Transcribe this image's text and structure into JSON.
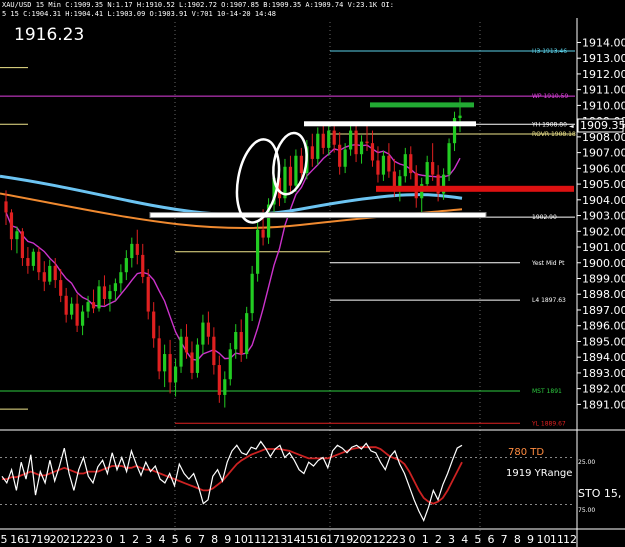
{
  "header": {
    "line1": "XAU/USD 15 Min C:1909.35 N:1.17 H:1910.52 L:1902.72 O:1907.85 B:1909.35 A:1909.74 V:23.1K OI:",
    "line2": "5 15 C:1904.31 H:1904.41 L:1903.09 O:1903.91 V:701 10-14-20 14:48"
  },
  "big_price": "1916.23",
  "current_price": "1909.35",
  "chart_data": {
    "type": "candlestick",
    "symbol": "XAU/USD",
    "timeframe": "15 Min",
    "ylim": [
      1889.5,
      1915.3
    ],
    "y_ticks": [
      1891,
      1892,
      1893,
      1894,
      1895,
      1896,
      1897,
      1898,
      1899,
      1900,
      1901,
      1902,
      1903,
      1904,
      1905,
      1906,
      1907,
      1908,
      1909,
      1910,
      1911,
      1912,
      1913,
      1914
    ],
    "y_tick_labels": [
      "1891.00",
      "1892.00",
      "1893.00",
      "1894.00",
      "1895.00",
      "1896.00",
      "1897.00",
      "1898.00",
      "1899.00",
      "1900.00",
      "1901.00",
      "1902.00",
      "1903.00",
      "1904.00",
      "1905.00",
      "1906.00",
      "1907.00",
      "1908.00",
      "1909.00",
      "1910.00",
      "1911.00",
      "1912.00",
      "1913.00",
      "1914.00"
    ],
    "x_labels": [
      "5",
      "16",
      "17",
      "19",
      "20",
      "21",
      "22",
      "23",
      "0",
      "1",
      "2",
      "3",
      "4",
      "5",
      "6",
      "7",
      "8",
      "9",
      "10",
      "11",
      "12",
      "13",
      "14",
      "15",
      "16",
      "17",
      "19",
      "20",
      "21",
      "22",
      "23",
      "0",
      "1",
      "2",
      "3",
      "4",
      "5",
      "6",
      "7",
      "8",
      "9",
      "10",
      "11",
      "12"
    ],
    "levels": [
      {
        "label": "H3 1913.46",
        "value": 1913.46,
        "color": "#5ad1e8"
      },
      {
        "label": "WP 1910.59",
        "value": 1910.59,
        "color": "#e040e0"
      },
      {
        "label": "YH 1908.80",
        "value": 1908.8,
        "color": "#ffffff"
      },
      {
        "label": "ROVR 1908.18",
        "value": 1908.18,
        "color": "#f0e68c"
      },
      {
        "label": "1902.90",
        "value": 1902.9,
        "color": "#ffffff"
      },
      {
        "label": "Yest Mid Pt",
        "value": 1900.0,
        "color": "#ffffff"
      },
      {
        "label": "L4 1897.63",
        "value": 1897.63,
        "color": "#ffffff"
      },
      {
        "label": "MST 1891",
        "value": 1891.85,
        "color": "#2ecc40"
      },
      {
        "label": "YL 1889.67",
        "value": 1889.8,
        "color": "#e02020"
      }
    ],
    "oscillator": {
      "label": "STO 15,",
      "td_label": "780 TD",
      "yrange_label": "1919 YRange",
      "levels": [
        "25.00",
        "75.00"
      ],
      "fast": [
        55,
        48,
        62,
        40,
        70,
        52,
        78,
        35,
        60,
        48,
        72,
        50,
        66,
        85,
        58,
        40,
        62,
        75,
        55,
        48,
        65,
        72,
        58,
        80,
        62,
        75,
        60,
        82,
        68,
        56,
        70,
        60,
        66,
        52,
        48,
        58,
        45,
        68,
        58,
        52,
        58,
        44,
        26,
        30,
        55,
        62,
        50,
        70,
        82,
        88,
        80,
        78,
        86,
        84,
        92,
        85,
        76,
        84,
        88,
        75,
        80,
        72,
        62,
        58,
        70,
        66,
        72,
        75,
        64,
        82,
        88,
        85,
        80,
        86,
        88,
        84,
        90,
        82,
        80,
        70,
        62,
        76,
        82,
        68,
        58,
        44,
        30,
        18,
        8,
        22,
        40,
        30,
        46,
        58,
        72,
        85,
        88
      ],
      "slow": [
        52,
        52,
        54,
        54,
        56,
        58,
        60,
        58,
        56,
        56,
        58,
        60,
        62,
        64,
        62,
        60,
        58,
        58,
        60,
        60,
        60,
        62,
        64,
        66,
        66,
        66,
        64,
        64,
        66,
        64,
        62,
        62,
        60,
        58,
        56,
        54,
        52,
        50,
        48,
        46,
        44,
        42,
        40,
        40,
        42,
        46,
        50,
        56,
        62,
        68,
        72,
        75,
        78,
        80,
        82,
        84,
        84,
        84,
        84,
        83,
        82,
        80,
        78,
        76,
        74,
        74,
        74,
        74,
        74,
        76,
        78,
        80,
        82,
        84,
        85,
        86,
        86,
        86,
        86,
        84,
        80,
        76,
        74,
        72,
        68,
        60,
        50,
        40,
        32,
        28,
        26,
        28,
        32,
        40,
        50,
        60,
        70
      ]
    },
    "candles": [
      [
        1903.9,
        1904.6,
        1902.4,
        1903.2
      ],
      [
        1903.2,
        1903.4,
        1900.8,
        1901.5
      ],
      [
        1901.5,
        1902.3,
        1900.6,
        1902.0
      ],
      [
        1902.0,
        1902.2,
        1899.8,
        1900.3
      ],
      [
        1900.3,
        1901.0,
        1899.3,
        1899.8
      ],
      [
        1899.8,
        1900.9,
        1899.5,
        1900.7
      ],
      [
        1900.7,
        1901.0,
        1898.9,
        1899.4
      ],
      [
        1899.4,
        1900.1,
        1898.2,
        1898.8
      ],
      [
        1898.8,
        1900.2,
        1898.6,
        1899.8
      ],
      [
        1899.8,
        1900.3,
        1898.4,
        1898.9
      ],
      [
        1898.9,
        1899.6,
        1897.5,
        1897.9
      ],
      [
        1897.9,
        1898.4,
        1896.2,
        1896.7
      ],
      [
        1896.7,
        1897.8,
        1896.4,
        1897.4
      ],
      [
        1897.4,
        1898.0,
        1895.6,
        1896.0
      ],
      [
        1896.0,
        1897.3,
        1895.4,
        1896.9
      ],
      [
        1896.9,
        1897.9,
        1896.5,
        1897.5
      ],
      [
        1897.5,
        1898.3,
        1896.8,
        1897.1
      ],
      [
        1897.1,
        1898.9,
        1896.9,
        1898.5
      ],
      [
        1898.5,
        1899.2,
        1897.3,
        1897.7
      ],
      [
        1897.7,
        1898.6,
        1896.9,
        1898.2
      ],
      [
        1898.2,
        1899.0,
        1897.6,
        1898.7
      ],
      [
        1898.7,
        1899.9,
        1898.1,
        1899.4
      ],
      [
        1899.4,
        1900.8,
        1898.9,
        1900.3
      ],
      [
        1900.3,
        1901.6,
        1899.7,
        1901.2
      ],
      [
        1901.2,
        1902.1,
        1899.9,
        1900.5
      ],
      [
        1900.5,
        1901.2,
        1898.7,
        1899.1
      ],
      [
        1899.1,
        1899.6,
        1896.4,
        1896.9
      ],
      [
        1896.9,
        1897.5,
        1894.6,
        1895.2
      ],
      [
        1895.2,
        1896.0,
        1892.6,
        1893.1
      ],
      [
        1893.1,
        1894.8,
        1892.1,
        1894.2
      ],
      [
        1894.2,
        1895.1,
        1891.7,
        1892.4
      ],
      [
        1892.4,
        1893.9,
        1891.5,
        1893.4
      ],
      [
        1893.4,
        1895.8,
        1893.0,
        1895.3
      ],
      [
        1895.3,
        1896.1,
        1893.9,
        1894.3
      ],
      [
        1894.3,
        1895.0,
        1892.6,
        1893.0
      ],
      [
        1893.0,
        1895.2,
        1892.7,
        1894.8
      ],
      [
        1894.8,
        1896.7,
        1894.2,
        1896.2
      ],
      [
        1896.2,
        1896.9,
        1894.8,
        1895.3
      ],
      [
        1895.3,
        1895.9,
        1892.9,
        1893.5
      ],
      [
        1893.5,
        1894.1,
        1891.1,
        1891.6
      ],
      [
        1891.6,
        1893.1,
        1890.8,
        1892.6
      ],
      [
        1892.6,
        1894.9,
        1892.2,
        1894.5
      ],
      [
        1894.5,
        1896.1,
        1893.9,
        1895.6
      ],
      [
        1895.6,
        1896.4,
        1893.7,
        1894.2
      ],
      [
        1894.2,
        1897.2,
        1893.9,
        1896.8
      ],
      [
        1896.8,
        1899.8,
        1896.3,
        1899.3
      ],
      [
        1899.3,
        1902.6,
        1898.8,
        1902.1
      ],
      [
        1902.1,
        1903.4,
        1901.1,
        1901.6
      ],
      [
        1901.6,
        1904.1,
        1901.2,
        1903.7
      ],
      [
        1903.7,
        1905.9,
        1903.1,
        1905.4
      ],
      [
        1905.4,
        1906.2,
        1903.6,
        1904.1
      ],
      [
        1904.1,
        1906.6,
        1903.8,
        1906.1
      ],
      [
        1906.1,
        1906.8,
        1904.4,
        1904.9
      ],
      [
        1904.9,
        1907.2,
        1904.5,
        1906.8
      ],
      [
        1906.8,
        1907.3,
        1905.2,
        1905.7
      ],
      [
        1905.7,
        1907.8,
        1905.3,
        1907.4
      ],
      [
        1907.4,
        1908.2,
        1906.1,
        1906.6
      ],
      [
        1906.6,
        1908.6,
        1906.2,
        1908.2
      ],
      [
        1908.2,
        1908.9,
        1906.9,
        1907.3
      ],
      [
        1907.3,
        1908.7,
        1906.8,
        1908.4
      ],
      [
        1908.4,
        1908.9,
        1907.0,
        1907.5
      ],
      [
        1907.5,
        1908.3,
        1905.6,
        1906.1
      ],
      [
        1906.1,
        1907.6,
        1905.7,
        1907.2
      ],
      [
        1907.2,
        1908.8,
        1906.8,
        1908.4
      ],
      [
        1908.4,
        1908.9,
        1906.4,
        1906.9
      ],
      [
        1906.9,
        1908.1,
        1906.3,
        1907.7
      ],
      [
        1907.7,
        1908.8,
        1907.1,
        1907.6
      ],
      [
        1907.6,
        1908.4,
        1906.1,
        1906.5
      ],
      [
        1906.5,
        1907.4,
        1905.1,
        1905.6
      ],
      [
        1905.6,
        1907.1,
        1905.2,
        1906.8
      ],
      [
        1906.8,
        1907.6,
        1905.4,
        1905.8
      ],
      [
        1905.8,
        1906.6,
        1904.2,
        1904.7
      ],
      [
        1904.7,
        1905.9,
        1903.9,
        1905.5
      ],
      [
        1905.5,
        1907.3,
        1905.1,
        1906.9
      ],
      [
        1906.9,
        1907.4,
        1905.3,
        1905.7
      ],
      [
        1905.7,
        1906.2,
        1903.5,
        1904.1
      ],
      [
        1904.1,
        1905.4,
        1903.2,
        1905.0
      ],
      [
        1905.0,
        1906.8,
        1904.6,
        1906.4
      ],
      [
        1906.4,
        1907.6,
        1905.2,
        1905.6
      ],
      [
        1905.6,
        1906.2,
        1903.9,
        1904.4
      ],
      [
        1904.4,
        1906.0,
        1904.0,
        1905.6
      ],
      [
        1905.6,
        1907.9,
        1905.2,
        1907.6
      ],
      [
        1907.6,
        1909.6,
        1907.1,
        1909.2
      ],
      [
        1909.2,
        1910.5,
        1908.3,
        1909.35
      ]
    ]
  }
}
